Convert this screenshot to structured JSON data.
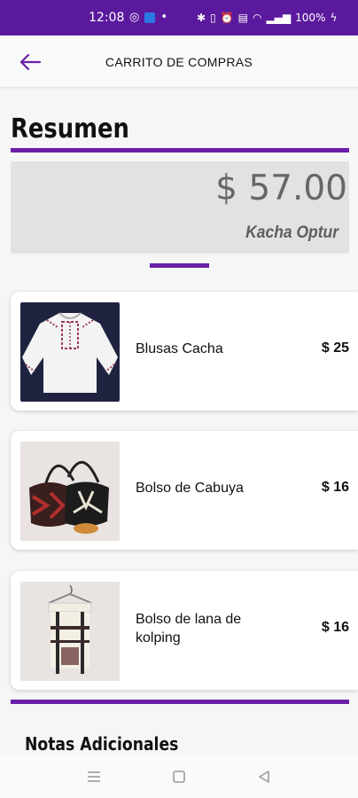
{
  "status": {
    "time": "12:08",
    "battery": "100%"
  },
  "appbar": {
    "title": "CARRITO DE COMPRAS",
    "back_icon": "arrow-left-icon"
  },
  "summary": {
    "heading": "Resumen",
    "total": "$ 57.00",
    "store": "Kacha Optur"
  },
  "cart": {
    "items": [
      {
        "name": "Blusas Cacha",
        "price": "$ 25",
        "image": "white-embroidered-blouse"
      },
      {
        "name": "Bolso de Cabuya",
        "price": "$ 16",
        "image": "woven-bags"
      },
      {
        "name": "Bolso de lana de kolping",
        "price": "$ 16",
        "image": "striped-wool-backpack"
      }
    ]
  },
  "notes": {
    "heading": "Notas Adicionales"
  },
  "colors": {
    "accent": "#6a1fa8",
    "statusbar": "#5b1a9e"
  }
}
